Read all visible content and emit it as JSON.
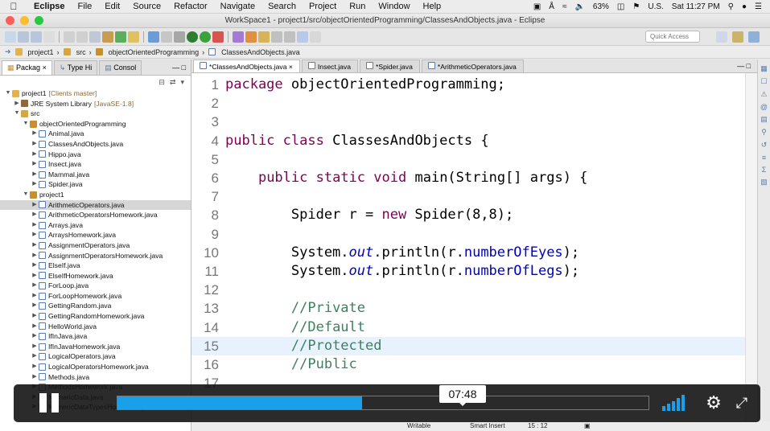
{
  "menubar": {
    "app": "Eclipse",
    "items": [
      "File",
      "Edit",
      "Source",
      "Refactor",
      "Navigate",
      "Search",
      "Project",
      "Run",
      "Window",
      "Help"
    ],
    "battery": "63%",
    "input_source": "U.S.",
    "clock": "Sat 11:27 PM"
  },
  "window": {
    "title": "WorkSpace1 - project1/src/objectOrientedProgramming/ClassesAndObjects.java - Eclipse"
  },
  "toolbar": {
    "quick_access_placeholder": "Quick Access"
  },
  "breadcrumb": {
    "items": [
      "project1",
      "src",
      "objectOrientedProgramming",
      "ClassesAndObjects.java"
    ]
  },
  "left_panel": {
    "tabs": [
      {
        "label": "Packag"
      },
      {
        "label": "Type Hi"
      },
      {
        "label": "Consol"
      }
    ],
    "tree": [
      {
        "label": "project1",
        "meta": "[Clients master]",
        "indent": 0,
        "icon": "proj",
        "tw": "▼"
      },
      {
        "label": "JRE System Library",
        "meta": "[JavaSE-1.8]",
        "indent": 1,
        "icon": "lib",
        "tw": "▶"
      },
      {
        "label": "src",
        "meta": "",
        "indent": 1,
        "icon": "src",
        "tw": "▼"
      },
      {
        "label": "objectOrientedProgramming",
        "meta": "",
        "indent": 2,
        "icon": "pkg",
        "tw": "▼"
      },
      {
        "label": "Animal.java",
        "meta": "",
        "indent": 3,
        "icon": "java",
        "tw": "▶"
      },
      {
        "label": "ClassesAndObjects.java",
        "meta": "",
        "indent": 3,
        "icon": "java",
        "tw": "▶"
      },
      {
        "label": "Hippo.java",
        "meta": "",
        "indent": 3,
        "icon": "java",
        "tw": "▶"
      },
      {
        "label": "Insect.java",
        "meta": "",
        "indent": 3,
        "icon": "java",
        "tw": "▶"
      },
      {
        "label": "Mammal.java",
        "meta": "",
        "indent": 3,
        "icon": "java",
        "tw": "▶"
      },
      {
        "label": "Spider.java",
        "meta": "",
        "indent": 3,
        "icon": "java",
        "tw": "▶"
      },
      {
        "label": "project1",
        "meta": "",
        "indent": 2,
        "icon": "pkg",
        "tw": "▼"
      },
      {
        "label": "ArithmeticOperators.java",
        "meta": "",
        "indent": 3,
        "icon": "java",
        "tw": "▶",
        "selected": true
      },
      {
        "label": "ArithmeticOperatorsHomework.java",
        "meta": "",
        "indent": 3,
        "icon": "java",
        "tw": "▶"
      },
      {
        "label": "Arrays.java",
        "meta": "",
        "indent": 3,
        "icon": "java",
        "tw": "▶"
      },
      {
        "label": "ArraysHomework.java",
        "meta": "",
        "indent": 3,
        "icon": "java",
        "tw": "▶"
      },
      {
        "label": "AssignmentOperators.java",
        "meta": "",
        "indent": 3,
        "icon": "java",
        "tw": "▶"
      },
      {
        "label": "AssignmentOperatorsHomework.java",
        "meta": "",
        "indent": 3,
        "icon": "java",
        "tw": "▶"
      },
      {
        "label": "ElseIf.java",
        "meta": "",
        "indent": 3,
        "icon": "java",
        "tw": "▶"
      },
      {
        "label": "ElseIfHomework.java",
        "meta": "",
        "indent": 3,
        "icon": "java",
        "tw": "▶"
      },
      {
        "label": "ForLoop.java",
        "meta": "",
        "indent": 3,
        "icon": "java",
        "tw": "▶"
      },
      {
        "label": "ForLoopHomework.java",
        "meta": "",
        "indent": 3,
        "icon": "java",
        "tw": "▶"
      },
      {
        "label": "GettingRandom.java",
        "meta": "",
        "indent": 3,
        "icon": "java",
        "tw": "▶"
      },
      {
        "label": "GettingRandomHomework.java",
        "meta": "",
        "indent": 3,
        "icon": "java",
        "tw": "▶"
      },
      {
        "label": "HelloWorld.java",
        "meta": "",
        "indent": 3,
        "icon": "java",
        "tw": "▶"
      },
      {
        "label": "IfInJava.java",
        "meta": "",
        "indent": 3,
        "icon": "java",
        "tw": "▶"
      },
      {
        "label": "IfInJavaHomework.java",
        "meta": "",
        "indent": 3,
        "icon": "java",
        "tw": "▶"
      },
      {
        "label": "LogicalOperators.java",
        "meta": "",
        "indent": 3,
        "icon": "java",
        "tw": "▶"
      },
      {
        "label": "LogicalOperatorsHomework.java",
        "meta": "",
        "indent": 3,
        "icon": "java",
        "tw": "▶"
      },
      {
        "label": "Methods.java",
        "meta": "",
        "indent": 3,
        "icon": "java",
        "tw": "▶"
      },
      {
        "label": "MethodsHomework.java",
        "meta": "",
        "indent": 3,
        "icon": "java",
        "tw": "▶"
      },
      {
        "label": "NumericData.java",
        "meta": "",
        "indent": 3,
        "icon": "java",
        "tw": "▶"
      },
      {
        "label": "NumericDataTypesHomework.java",
        "meta": "",
        "indent": 3,
        "icon": "java",
        "tw": "▶"
      }
    ]
  },
  "editor": {
    "tabs": [
      {
        "label": "*ClassesAndObjects.java",
        "active": true
      },
      {
        "label": "Insect.java",
        "active": false
      },
      {
        "label": "*Spider.java",
        "active": false
      },
      {
        "label": "*ArithmeticOperators.java",
        "active": false
      }
    ],
    "lines": [
      {
        "n": "1",
        "html": "<span class=\"kw\">package</span> objectOrientedProgramming;"
      },
      {
        "n": "2",
        "html": ""
      },
      {
        "n": "3",
        "html": ""
      },
      {
        "n": "4",
        "html": "<span class=\"kw\">public</span> <span class=\"kw\">class</span> ClassesAndObjects {"
      },
      {
        "n": "5",
        "html": ""
      },
      {
        "n": "6",
        "html": "    <span class=\"kw\">public</span> <span class=\"kw\">static</span> <span class=\"kw\">void</span> main(String[] args) {"
      },
      {
        "n": "7",
        "html": ""
      },
      {
        "n": "8",
        "html": "        Spider r = <span class=\"kw\">new</span> Spider(8,8);"
      },
      {
        "n": "9",
        "html": ""
      },
      {
        "n": "10",
        "html": "        System.<span class=\"st\">out</span>.println(r.<span class=\"fd\">numberOfEyes</span>);"
      },
      {
        "n": "11",
        "html": "        System.<span class=\"st\">out</span>.println(r.<span class=\"fd\">numberOfLegs</span>);"
      },
      {
        "n": "12",
        "html": ""
      },
      {
        "n": "13",
        "html": "        <span class=\"cm\">//Private</span>"
      },
      {
        "n": "14",
        "html": "        <span class=\"cm\">//Default</span>"
      },
      {
        "n": "15",
        "html": "        <span class=\"cm\">//Protected</span>",
        "current": true
      },
      {
        "n": "16",
        "html": "        <span class=\"cm\">//Public</span>"
      },
      {
        "n": "17",
        "html": ""
      }
    ]
  },
  "statusbar": {
    "mode": "Writable",
    "insert": "Smart Insert",
    "position": "15 : 12"
  },
  "video": {
    "time_tooltip": "07:48",
    "progress_fraction": 0.46,
    "volume_fraction": 1.0,
    "accent": "#1aa0e8"
  }
}
